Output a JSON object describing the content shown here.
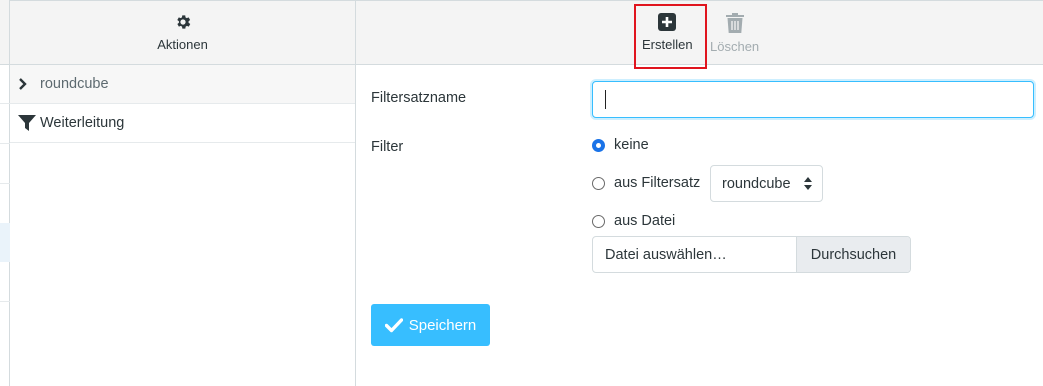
{
  "actions_header": {
    "label": "Aktionen",
    "icon": "gear-icon"
  },
  "toolbar": {
    "create_label": "Erstellen",
    "delete_label": "Löschen"
  },
  "filter_list": {
    "group_label": "roundcube",
    "items": [
      {
        "label": "Weiterleitung",
        "icon": "filter-icon"
      }
    ]
  },
  "form": {
    "name_label": "Filtersatzname",
    "name_value": "",
    "filter_label": "Filter",
    "options": [
      {
        "label": "keine",
        "checked": true
      },
      {
        "label": "aus Filtersatz",
        "checked": false
      },
      {
        "label": "aus Datei",
        "checked": false
      }
    ],
    "filterset_select_value": "roundcube",
    "file_placeholder": "Datei auswählen…",
    "browse_label": "Durchsuchen",
    "save_label": "Speichern"
  },
  "colors": {
    "accent": "#37beff",
    "highlight_border": "#e0141e",
    "header_bg": "#f4f4f4"
  }
}
